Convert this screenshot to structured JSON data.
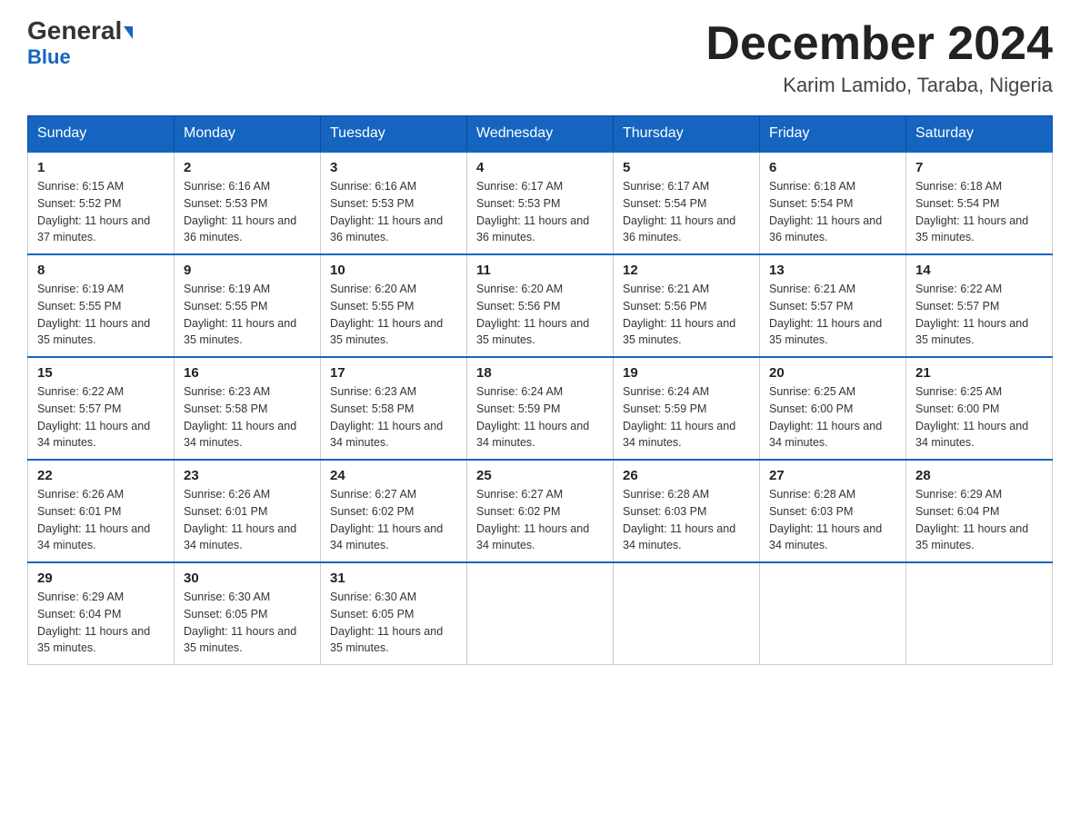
{
  "header": {
    "logo_general": "General",
    "logo_blue": "Blue",
    "month_title": "December 2024",
    "location": "Karim Lamido, Taraba, Nigeria"
  },
  "days_of_week": [
    "Sunday",
    "Monday",
    "Tuesday",
    "Wednesday",
    "Thursday",
    "Friday",
    "Saturday"
  ],
  "weeks": [
    [
      {
        "day": "1",
        "sunrise": "6:15 AM",
        "sunset": "5:52 PM",
        "daylight": "11 hours and 37 minutes."
      },
      {
        "day": "2",
        "sunrise": "6:16 AM",
        "sunset": "5:53 PM",
        "daylight": "11 hours and 36 minutes."
      },
      {
        "day": "3",
        "sunrise": "6:16 AM",
        "sunset": "5:53 PM",
        "daylight": "11 hours and 36 minutes."
      },
      {
        "day": "4",
        "sunrise": "6:17 AM",
        "sunset": "5:53 PM",
        "daylight": "11 hours and 36 minutes."
      },
      {
        "day": "5",
        "sunrise": "6:17 AM",
        "sunset": "5:54 PM",
        "daylight": "11 hours and 36 minutes."
      },
      {
        "day": "6",
        "sunrise": "6:18 AM",
        "sunset": "5:54 PM",
        "daylight": "11 hours and 36 minutes."
      },
      {
        "day": "7",
        "sunrise": "6:18 AM",
        "sunset": "5:54 PM",
        "daylight": "11 hours and 35 minutes."
      }
    ],
    [
      {
        "day": "8",
        "sunrise": "6:19 AM",
        "sunset": "5:55 PM",
        "daylight": "11 hours and 35 minutes."
      },
      {
        "day": "9",
        "sunrise": "6:19 AM",
        "sunset": "5:55 PM",
        "daylight": "11 hours and 35 minutes."
      },
      {
        "day": "10",
        "sunrise": "6:20 AM",
        "sunset": "5:55 PM",
        "daylight": "11 hours and 35 minutes."
      },
      {
        "day": "11",
        "sunrise": "6:20 AM",
        "sunset": "5:56 PM",
        "daylight": "11 hours and 35 minutes."
      },
      {
        "day": "12",
        "sunrise": "6:21 AM",
        "sunset": "5:56 PM",
        "daylight": "11 hours and 35 minutes."
      },
      {
        "day": "13",
        "sunrise": "6:21 AM",
        "sunset": "5:57 PM",
        "daylight": "11 hours and 35 minutes."
      },
      {
        "day": "14",
        "sunrise": "6:22 AM",
        "sunset": "5:57 PM",
        "daylight": "11 hours and 35 minutes."
      }
    ],
    [
      {
        "day": "15",
        "sunrise": "6:22 AM",
        "sunset": "5:57 PM",
        "daylight": "11 hours and 34 minutes."
      },
      {
        "day": "16",
        "sunrise": "6:23 AM",
        "sunset": "5:58 PM",
        "daylight": "11 hours and 34 minutes."
      },
      {
        "day": "17",
        "sunrise": "6:23 AM",
        "sunset": "5:58 PM",
        "daylight": "11 hours and 34 minutes."
      },
      {
        "day": "18",
        "sunrise": "6:24 AM",
        "sunset": "5:59 PM",
        "daylight": "11 hours and 34 minutes."
      },
      {
        "day": "19",
        "sunrise": "6:24 AM",
        "sunset": "5:59 PM",
        "daylight": "11 hours and 34 minutes."
      },
      {
        "day": "20",
        "sunrise": "6:25 AM",
        "sunset": "6:00 PM",
        "daylight": "11 hours and 34 minutes."
      },
      {
        "day": "21",
        "sunrise": "6:25 AM",
        "sunset": "6:00 PM",
        "daylight": "11 hours and 34 minutes."
      }
    ],
    [
      {
        "day": "22",
        "sunrise": "6:26 AM",
        "sunset": "6:01 PM",
        "daylight": "11 hours and 34 minutes."
      },
      {
        "day": "23",
        "sunrise": "6:26 AM",
        "sunset": "6:01 PM",
        "daylight": "11 hours and 34 minutes."
      },
      {
        "day": "24",
        "sunrise": "6:27 AM",
        "sunset": "6:02 PM",
        "daylight": "11 hours and 34 minutes."
      },
      {
        "day": "25",
        "sunrise": "6:27 AM",
        "sunset": "6:02 PM",
        "daylight": "11 hours and 34 minutes."
      },
      {
        "day": "26",
        "sunrise": "6:28 AM",
        "sunset": "6:03 PM",
        "daylight": "11 hours and 34 minutes."
      },
      {
        "day": "27",
        "sunrise": "6:28 AM",
        "sunset": "6:03 PM",
        "daylight": "11 hours and 34 minutes."
      },
      {
        "day": "28",
        "sunrise": "6:29 AM",
        "sunset": "6:04 PM",
        "daylight": "11 hours and 35 minutes."
      }
    ],
    [
      {
        "day": "29",
        "sunrise": "6:29 AM",
        "sunset": "6:04 PM",
        "daylight": "11 hours and 35 minutes."
      },
      {
        "day": "30",
        "sunrise": "6:30 AM",
        "sunset": "6:05 PM",
        "daylight": "11 hours and 35 minutes."
      },
      {
        "day": "31",
        "sunrise": "6:30 AM",
        "sunset": "6:05 PM",
        "daylight": "11 hours and 35 minutes."
      },
      null,
      null,
      null,
      null
    ]
  ]
}
